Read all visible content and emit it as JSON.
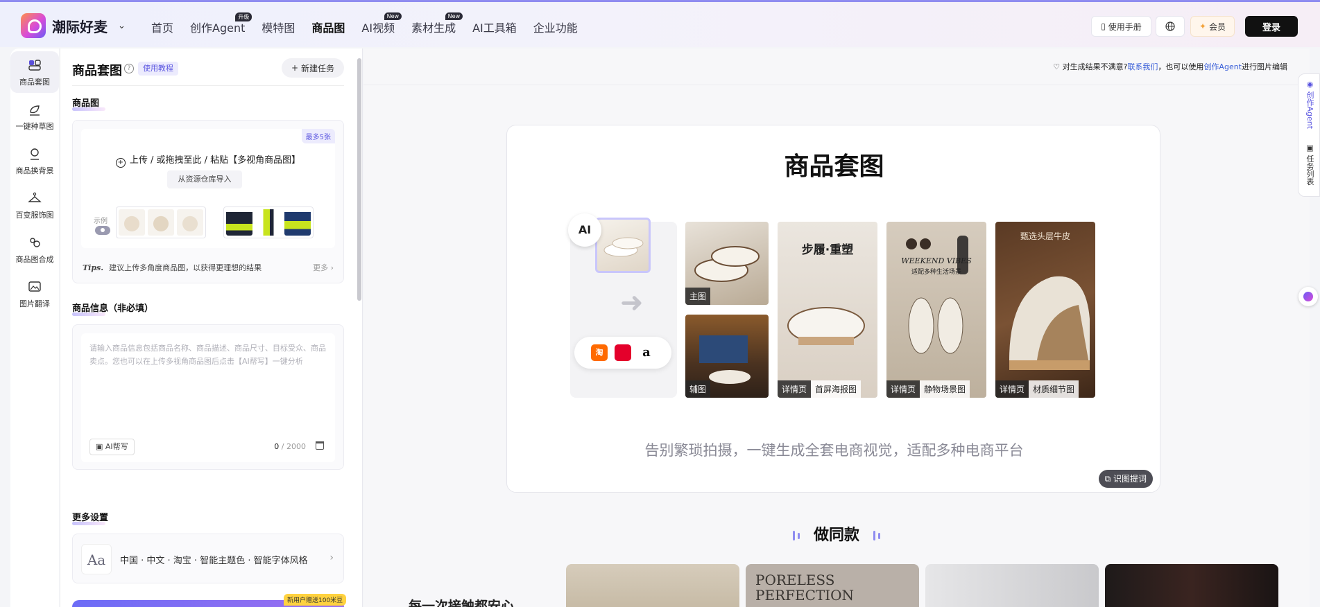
{
  "header": {
    "brand": "潮际好麦",
    "nav": [
      {
        "label": "首页",
        "badge": ""
      },
      {
        "label": "创作Agent",
        "badge": "升级"
      },
      {
        "label": "模特图",
        "badge": ""
      },
      {
        "label": "商品图",
        "badge": ""
      },
      {
        "label": "AI视频",
        "badge": "New"
      },
      {
        "label": "素材生成",
        "badge": "New"
      },
      {
        "label": "AI工具箱",
        "badge": ""
      },
      {
        "label": "企业功能",
        "badge": ""
      }
    ],
    "manual": "使用手册",
    "vip": "会员",
    "login": "登录"
  },
  "leftnav": [
    {
      "label": "商品套图"
    },
    {
      "label": "一键种草图"
    },
    {
      "label": "商品换背景"
    },
    {
      "label": "百变服饰图"
    },
    {
      "label": "商品图合成"
    },
    {
      "label": "图片翻译"
    }
  ],
  "panel": {
    "title": "商品套图",
    "help": "?",
    "tutorial": "使用教程",
    "new_task": "新建任务",
    "product_image": {
      "title": "商品图",
      "max_badge": "最多5张",
      "upload_text": "上传 / 或拖拽至此 / 粘贴【多视角商品图】",
      "import_button": "从资源仓库导入",
      "example_label": "示例",
      "tips_label": "Tips.",
      "tips_text": "建议上传多角度商品图，以获得更理想的结果",
      "more": "更多"
    },
    "product_info": {
      "title": "商品信息（非必填）",
      "placeholder": "请输入商品信息包括商品名称、商品描述、商品尺寸、目标受众、商品卖点。您也可以在上传多视角商品图后点击【AI帮写】一键分析",
      "ai_write": "AI帮写",
      "count": "0",
      "max": "/ 2000"
    },
    "more_settings": {
      "title": "更多设置",
      "icon_text": "Aa",
      "summary": "中国 · 中文 · 淘宝 · 智能主题色 · 智能字体风格"
    },
    "new_user_badge": "新用户赠送100米豆"
  },
  "main": {
    "notice": {
      "prefix": "对生成结果不满意?",
      "link1": "联系我们",
      "middle": "，也可以使用",
      "link2": "创作Agent",
      "suffix": "进行图片编辑"
    },
    "card": {
      "title": "商品套图",
      "ai_label": "AI",
      "platforms": [
        "淘",
        "",
        "a"
      ],
      "images": [
        {
          "tags": [
            "主图"
          ]
        },
        {
          "tags": [
            "辅图"
          ]
        },
        {
          "tags": [
            "详情页",
            "首屏海报图"
          ],
          "poster": "步履·重塑"
        },
        {
          "tags": [
            "详情页",
            "静物场景图"
          ],
          "poster": "WEEKEND VIBES",
          "poster_sub": "适配多种生活场景"
        },
        {
          "tags": [
            "详情页",
            "材质细节图"
          ],
          "poster": "甄选头层牛皮"
        }
      ],
      "subtitle": "告别繁琐拍摄，一键生成全套电商视觉，适配多种电商平台",
      "ai_help": "识图提词"
    },
    "same_style": {
      "title": "做同款",
      "heading": "每一次接触都安心",
      "card2_text": "PORELESS PERFECTION"
    }
  },
  "right_rail": [
    "创作Agent",
    "任务列表"
  ]
}
